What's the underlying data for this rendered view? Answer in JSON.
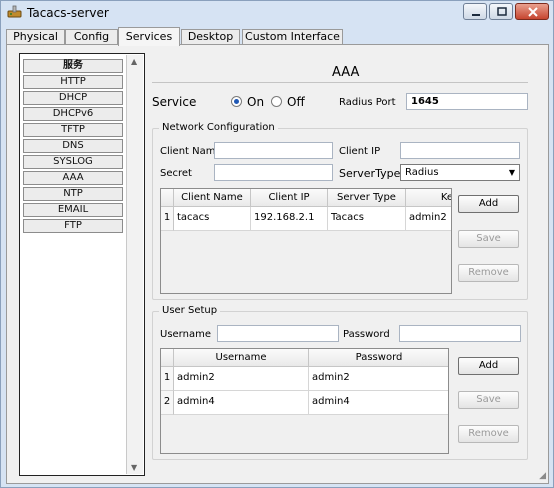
{
  "window": {
    "title": "Tacacs-server",
    "icon": "router-icon",
    "controls": [
      "minimize-icon",
      "maximize-icon",
      "close-icon"
    ]
  },
  "tabs": [
    "Physical",
    "Config",
    "Services",
    "Desktop",
    "Custom Interface"
  ],
  "active_tab": "Services",
  "services_list": {
    "items": [
      "服务",
      "HTTP",
      "DHCP",
      "DHCPv6",
      "TFTP",
      "DNS",
      "SYSLOG",
      "AAA",
      "NTP",
      "EMAIL",
      "FTP"
    ],
    "selected": "服务"
  },
  "page_title": "AAA",
  "service": {
    "label": "Service",
    "on_label": "On",
    "off_label": "Off",
    "state": "On",
    "radius_port_label": "Radius Port",
    "radius_port_value": "1645"
  },
  "network_config": {
    "legend": "Network Configuration",
    "client_name_label": "Client Name",
    "client_name_value": "",
    "client_ip_label": "Client IP",
    "client_ip_value": "",
    "secret_label": "Secret",
    "secret_value": "",
    "server_type_label": "ServerType",
    "server_type_value": "Radius",
    "columns": [
      "Client Name",
      "Client IP",
      "Server Type",
      "Key"
    ],
    "rows": [
      {
        "num": "1",
        "cells": [
          "tacacs",
          "192.168.2.1",
          "Tacacs",
          "admin2"
        ]
      }
    ],
    "buttons": {
      "add": "Add",
      "save": "Save",
      "remove": "Remove"
    }
  },
  "user_setup": {
    "legend": "User Setup",
    "username_label": "Username",
    "username_value": "",
    "password_label": "Password",
    "password_value": "",
    "columns": [
      "Username",
      "Password"
    ],
    "rows": [
      {
        "num": "1",
        "cells": [
          "admin2",
          "admin2"
        ]
      },
      {
        "num": "2",
        "cells": [
          "admin4",
          "admin4"
        ]
      }
    ],
    "buttons": {
      "add": "Add",
      "save": "Save",
      "remove": "Remove"
    }
  },
  "colors": {
    "window_frame": "#d6e3f3",
    "panel_bg": "#f0f0f0",
    "radio_selected": "#1f58b5",
    "close_button": "#c6452f"
  }
}
